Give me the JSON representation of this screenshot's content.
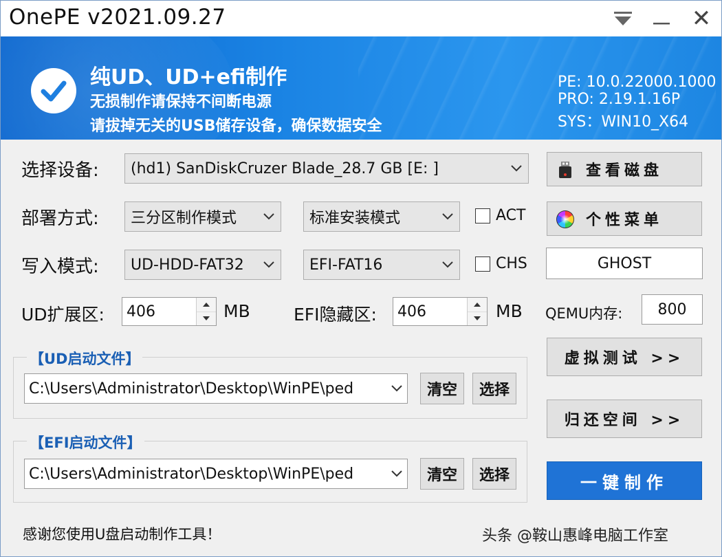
{
  "window": {
    "title": "OnePE v2021.09.27",
    "close_glyph": "✕"
  },
  "banner": {
    "title": "纯UD、UD+efi制作",
    "line1": "无损制作请保持不间断电源",
    "line2": "请拔掉无关的USB储存设备，确保数据安全",
    "pe": "PE: 10.0.22000.1000",
    "pro": "PRO: 2.19.1.16P",
    "sys": "SYS：WIN10_X64"
  },
  "form": {
    "device_label": "选择设备:",
    "device_value": "(hd1) SanDiskCruzer Blade_28.7 GB [E: ]",
    "deploy_label": "部署方式:",
    "deploy_value": "三分区制作模式",
    "install_value": "标准安装模式",
    "act_label": "ACT",
    "write_label": "写入模式:",
    "write_value": "UD-HDD-FAT32",
    "efi_fs_value": "EFI-FAT16",
    "chs_label": "CHS",
    "ud_ext_label": "UD扩展区:",
    "ud_ext_value": "406",
    "ud_ext_unit": "MB",
    "efi_hidden_label": "EFI隐藏区:",
    "efi_hidden_value": "406",
    "efi_hidden_unit": "MB",
    "qemu_label": "QEMU内存:",
    "qemu_value": "800"
  },
  "buttons": {
    "view_disk": "查看磁盘",
    "custom_menu": "个性菜单",
    "ghost": "GHOST",
    "virtual_test": "虚拟测试 >>",
    "restore_space": "归还空间 >>",
    "one_click": "一键制作"
  },
  "ud_group": {
    "title": "【UD启动文件】",
    "path": "C:\\Users\\Administrator\\Desktop\\WinPE\\ped",
    "clear": "清空",
    "select": "选择"
  },
  "efi_group": {
    "title": "【EFI启动文件】",
    "path": "C:\\Users\\Administrator\\Desktop\\WinPE\\ped",
    "clear": "清空",
    "select": "选择"
  },
  "status": {
    "message": "感谢您使用U盘启动制作工具！",
    "watermark": "头条 @鞍山惠峰电脑工作室"
  },
  "colors": {
    "banner": "#1b84e4",
    "primary_button": "#1f73d6",
    "group_title": "#1a5fb4"
  }
}
